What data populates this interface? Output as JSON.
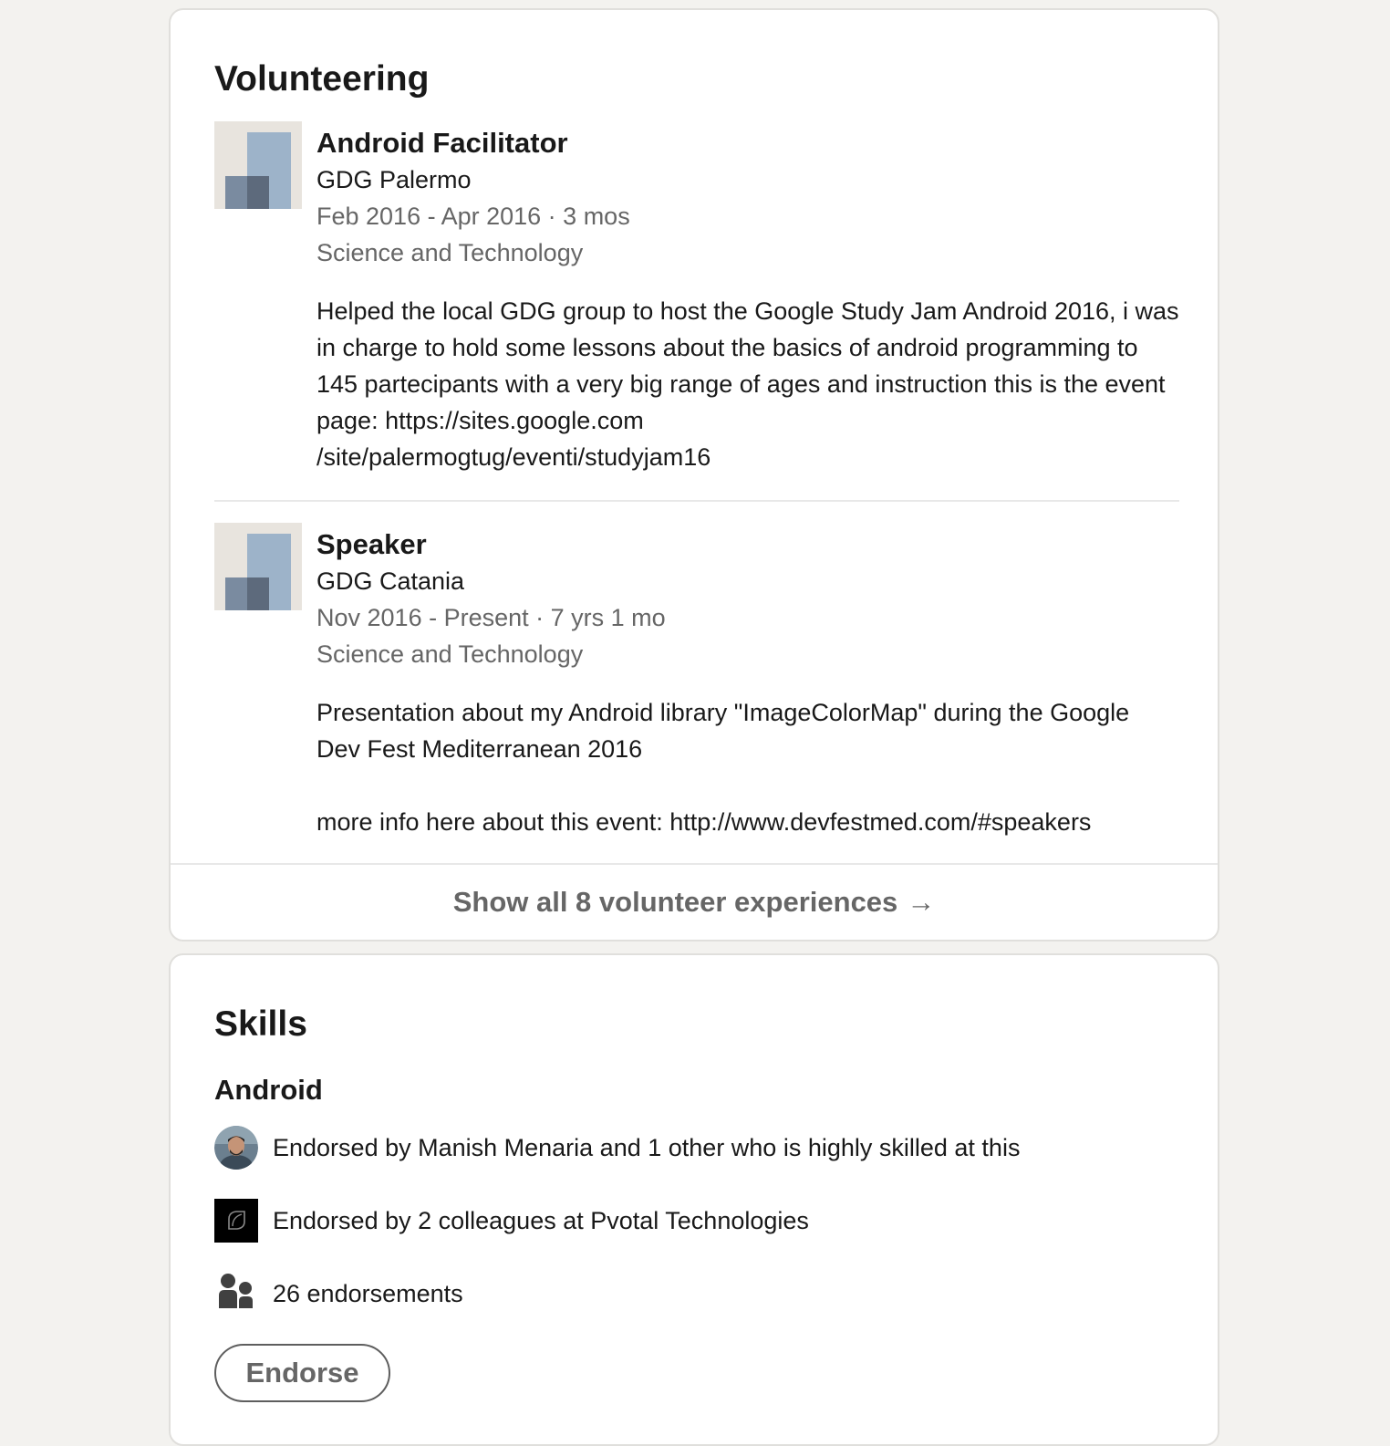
{
  "volunteering": {
    "title": "Volunteering",
    "items": [
      {
        "role": "Android Facilitator",
        "org": "GDG Palermo",
        "dates": "Feb 2016 - Apr 2016 · 3 mos",
        "cause": "Science and Technology",
        "description": "Helped the local GDG group to host the Google Study Jam Android 2016, i was in charge to hold some lessons about the basics of android programming to 145 partecipants with a very big range of ages and instruction this is the event page: https://sites.google.com\n/site/palermogtug/eventi/studyjam16"
      },
      {
        "role": "Speaker",
        "org": "GDG Catania",
        "dates": "Nov 2016 - Present · 7 yrs 1 mo",
        "cause": "Science and Technology",
        "description": "Presentation about my Android library \"ImageColorMap\" during the Google Dev Fest Mediterranean 2016\n\nmore info here about this event: http://www.devfestmed.com/#speakers"
      }
    ],
    "show_all_label": "Show all 8 volunteer experiences",
    "show_all_arrow": "→"
  },
  "skills": {
    "title": "Skills",
    "skill": {
      "name": "Android",
      "endorsements": [
        {
          "icon": "avatar",
          "text": "Endorsed by Manish Menaria and 1 other who is highly skilled at this"
        },
        {
          "icon": "company-logo",
          "text": "Endorsed by 2 colleagues at Pvotal Technologies"
        },
        {
          "icon": "people-icon",
          "text": "26 endorsements"
        }
      ]
    },
    "endorse_label": "Endorse"
  },
  "colors": {
    "page_background": "#f3f2ef",
    "card_background": "#ffffff",
    "primary_text": "#191919",
    "secondary_text": "#666666",
    "logo_placeholder_bg": "#e8e4de",
    "logo_placeholder_light": "#9db3c9",
    "logo_placeholder_dark": "#5d6a7c"
  }
}
